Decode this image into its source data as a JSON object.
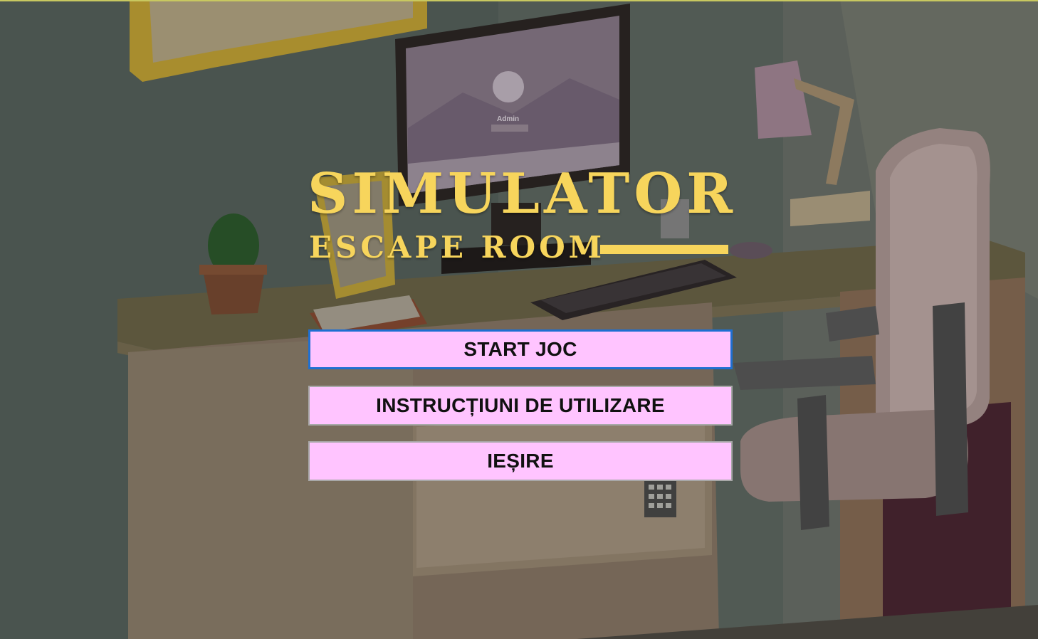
{
  "title": {
    "main": "SIMULATOR",
    "sub": "ESCAPE ROOM"
  },
  "menu": {
    "start_label": "START JOC",
    "instructions_label": "INSTRUCȚIUNI DE UTILIZARE",
    "exit_label": "IEȘIRE"
  },
  "screen_login": {
    "username": "Admin"
  },
  "colors": {
    "title": "#f7d55c",
    "button_bg": "#ffc4ff",
    "button_focus_border": "#1f6fd1"
  }
}
